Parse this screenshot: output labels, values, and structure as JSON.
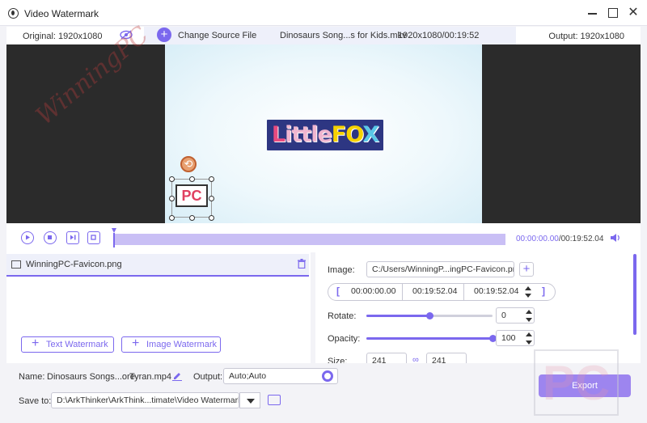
{
  "window": {
    "title": "Video Watermark"
  },
  "infobar": {
    "original_label": "Original: 1920x1080",
    "change_source_label": "Change Source File",
    "file_name": "Dinosaurs Song...s for Kids.mkv",
    "file_dims": "1920x1080/00:19:52",
    "output_label": "Output: 1920x1080"
  },
  "preview": {
    "video_logo_text": [
      "L",
      "ittle",
      "F",
      "O",
      "X"
    ],
    "watermark_text": "PC",
    "ghost_watermark": "WinningPC"
  },
  "playback": {
    "current_time": "00:00:00.00",
    "total_time": "/00:19:52.04"
  },
  "layers": {
    "items": [
      {
        "label": "WinningPC-Favicon.png"
      }
    ],
    "text_watermark_label": "Text Watermark",
    "image_watermark_label": "Image Watermark"
  },
  "settings": {
    "image_label": "Image:",
    "image_path": "C:/Users/WinningP...ingPC-Favicon.png",
    "start_time": "00:00:00.00",
    "end_time": "00:19:52.04",
    "duration": "00:19:52.04",
    "bracket_open": "[",
    "bracket_close": "]",
    "rotate_label": "Rotate:",
    "rotate_value": "0",
    "rotate_slider_fraction": 0.5,
    "opacity_label": "Opacity:",
    "opacity_value": "100",
    "opacity_slider_fraction": 1.0,
    "size_label": "Size:",
    "size_width": "241",
    "size_height": "241"
  },
  "bottom": {
    "name_label": "Name:",
    "name_value": "Dinosaurs Songs...ore",
    "name_ext": "Tyran.mp4",
    "output_label": "Output:",
    "output_value": "Auto;Auto",
    "save_label": "Save to:",
    "save_path": "D:\\ArkThinker\\ArkThink...timate\\Video Watermark",
    "export_label": "Export"
  },
  "colors": {
    "accent": "#7b68ee",
    "export": "#9d85ef",
    "preview_bg": "#2b2b2b"
  }
}
